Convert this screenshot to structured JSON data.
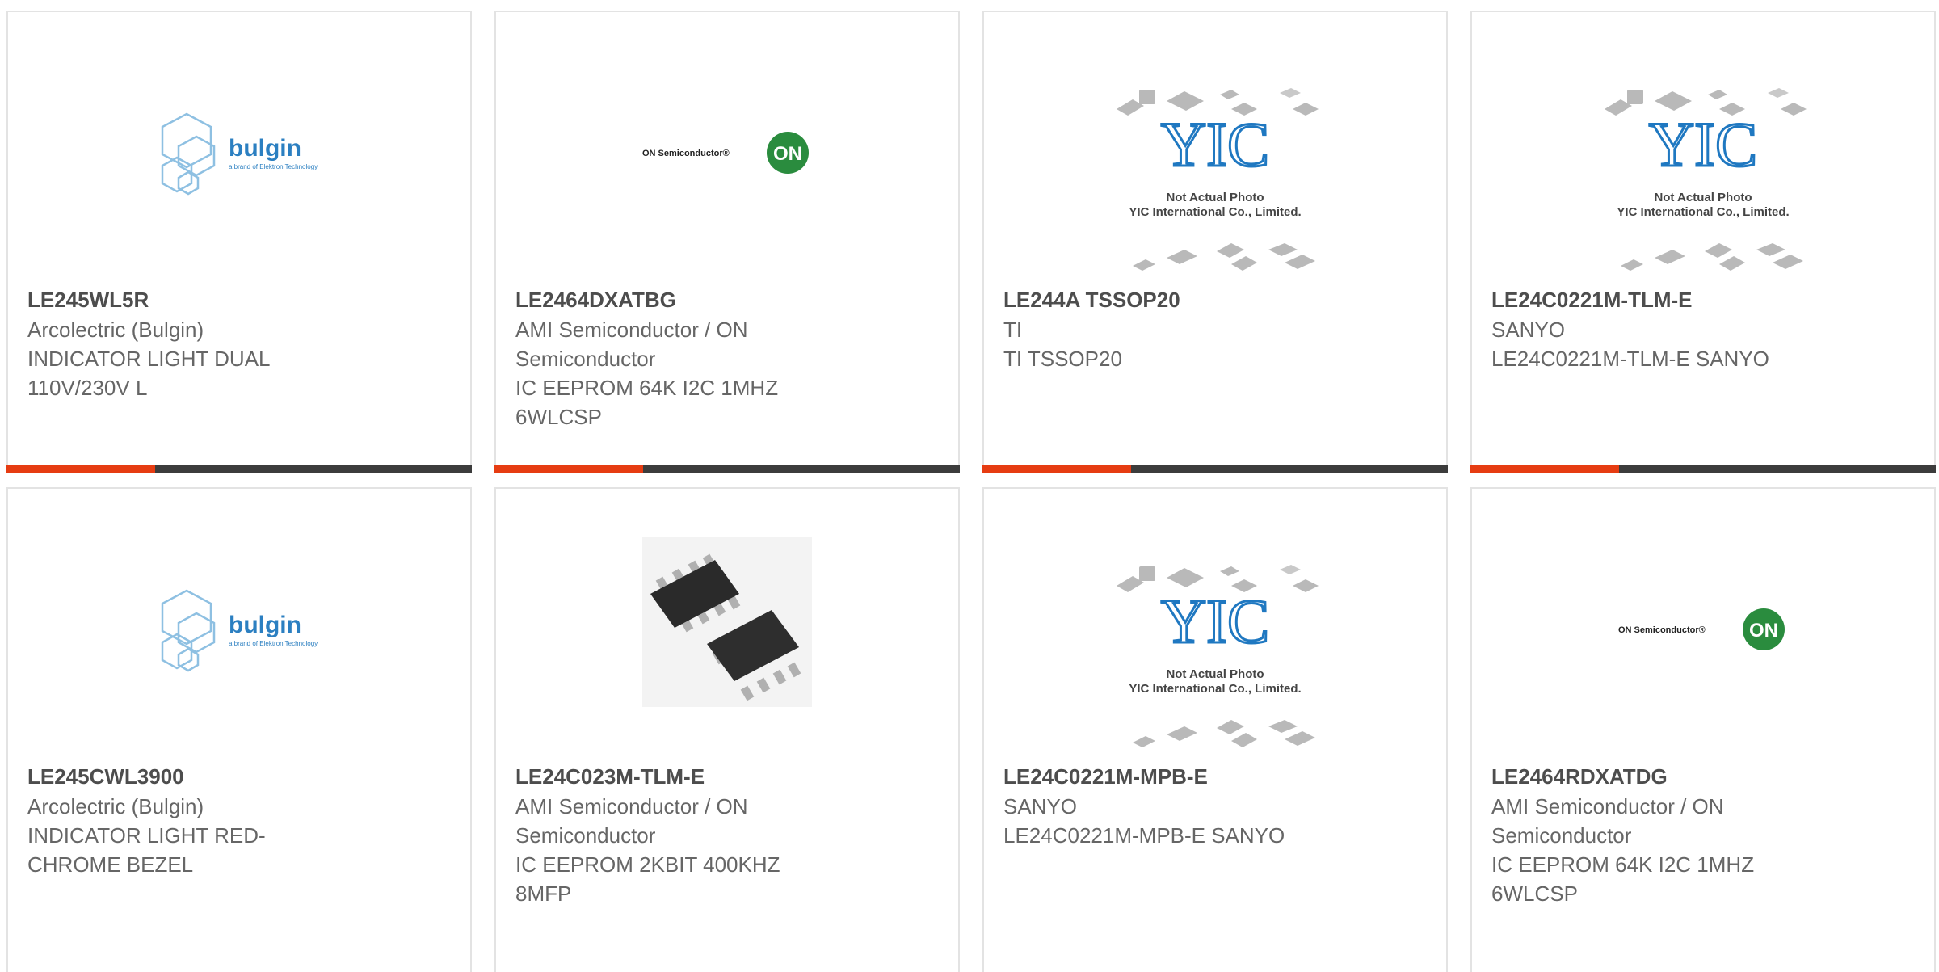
{
  "products": [
    {
      "part": "LE245WL5R",
      "maker": "Arcolectric (Bulgin)",
      "desc_lines": [
        "INDICATOR LIGHT DUAL",
        "110V/230V L"
      ],
      "image": "bulgin-logo"
    },
    {
      "part": "LE2464DXATBG",
      "maker": "AMI Semiconductor / ON Semiconductor",
      "desc_lines": [
        "IC EEPROM 64K I2C 1MHZ",
        "6WLCSP"
      ],
      "image": "onsemi-logo"
    },
    {
      "part": "LE244A TSSOP20",
      "maker": "TI",
      "desc_lines": [
        "TI TSSOP20"
      ],
      "image": "yic-placeholder"
    },
    {
      "part": "LE24C0221M-TLM-E",
      "maker": "SANYO",
      "desc_lines": [
        "LE24C0221M-TLM-E SANYO"
      ],
      "image": "yic-placeholder"
    },
    {
      "part": "LE245CWL3900",
      "maker": "Arcolectric (Bulgin)",
      "desc_lines": [
        "INDICATOR LIGHT RED-",
        "CHROME BEZEL"
      ],
      "image": "bulgin-logo"
    },
    {
      "part": "LE24C023M-TLM-E",
      "maker": "AMI Semiconductor / ON Semiconductor",
      "desc_lines": [
        "IC EEPROM 2KBIT 400KHZ",
        "8MFP"
      ],
      "image": "soic-chip-photo"
    },
    {
      "part": "LE24C0221M-MPB-E",
      "maker": "SANYO",
      "desc_lines": [
        "LE24C0221M-MPB-E SANYO"
      ],
      "image": "yic-placeholder"
    },
    {
      "part": "LE2464RDXATDG",
      "maker": "AMI Semiconductor / ON Semiconductor",
      "desc_lines": [
        "IC EEPROM 64K I2C 1MHZ",
        "6WLCSP"
      ],
      "image": "onsemi-logo"
    }
  ],
  "logos": {
    "bulgin_word": "bulgin",
    "bulgin_tagline": "a brand of Elektron Technology",
    "on_text": "ON Semiconductor®",
    "on_badge": "ON",
    "yic_mark": "YIC",
    "yic_line1": "Not Actual Photo",
    "yic_line2": "YIC International Co., Limited."
  },
  "colors": {
    "accent": "#e63c12",
    "bar": "#3c3c3c",
    "on_green": "#2a8c3e",
    "bulgin_blue": "#2b7fc1"
  }
}
